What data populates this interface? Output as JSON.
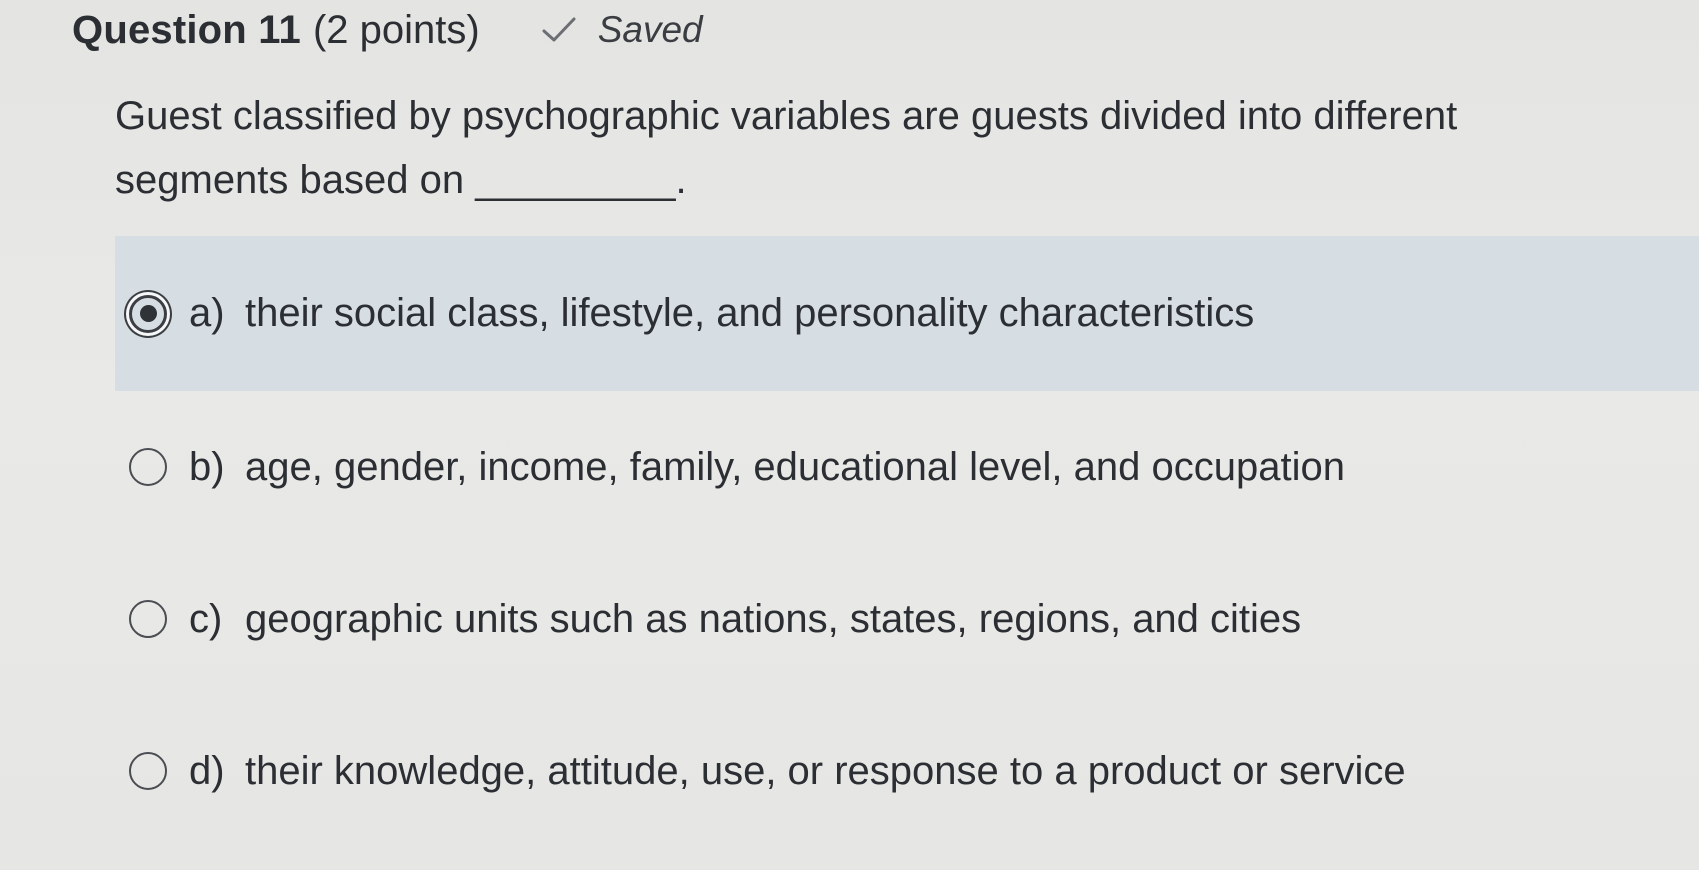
{
  "question": {
    "title": "Question 11",
    "points": "(2 points)",
    "status": "Saved",
    "status_icon": "check-icon",
    "prompt": "Guest classified by psychographic variables are guests divided into different segments based on _________."
  },
  "options": [
    {
      "letter": "a)",
      "text": "their social class, lifestyle, and personality characteristics",
      "selected": true
    },
    {
      "letter": "b)",
      "text": "age, gender, income, family, educational level, and occupation",
      "selected": false
    },
    {
      "letter": "c)",
      "text": "geographic units such as nations, states, regions, and cities",
      "selected": false
    },
    {
      "letter": "d)",
      "text": "their knowledge, attitude, use, or response to a product or service",
      "selected": false
    }
  ],
  "colors": {
    "selected_row_bg": "#d6dde3",
    "text": "#2b2e33",
    "page_bg": "#e7e7e5"
  }
}
